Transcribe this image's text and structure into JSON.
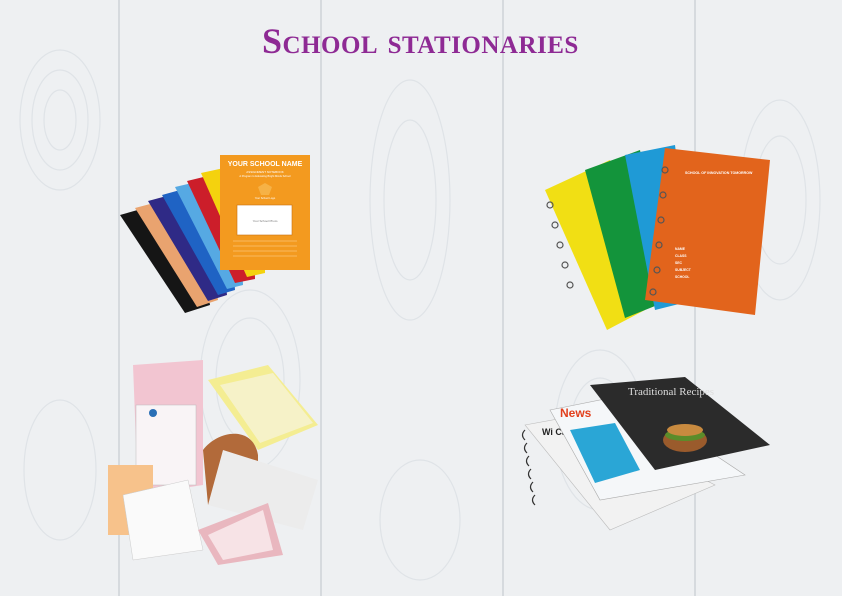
{
  "page": {
    "title": "School stationaries"
  },
  "products": [
    {
      "id": "exercise-books",
      "cover_heading": "YOUR SCHOOL NAME",
      "cover_lines": [
        "ASSIGNMENT NOTEBOOK",
        "A Program to Educating Bright Minds School"
      ],
      "cover_logo_text": "Your School Logo",
      "cover_label_box": "Your School Photo",
      "colors": [
        "#151515",
        "#e9a36f",
        "#2f2a86",
        "#1f63c4",
        "#56a9e3",
        "#cc1e2a",
        "#f4d20e",
        "#f39a1f"
      ]
    },
    {
      "id": "spiral-notebooks",
      "cover_heading": "SCHOOL OF INNOVATION TOMORROW",
      "cover_lines": [
        "NAME",
        "CLASS",
        "SEC",
        "SUBJECT",
        "SCHOOL"
      ],
      "colors": [
        "#f1df14",
        "#13943b",
        "#1f9ad6",
        "#e2641c"
      ]
    },
    {
      "id": "bill-books",
      "colors": [
        "#f2c5d1",
        "#f4ed92",
        "#f6f2c8",
        "#b26a3a"
      ]
    },
    {
      "id": "booklets",
      "cover_title": "Traditional Recipes",
      "mid_title": "News",
      "back_title": "Wi Cat",
      "colors": [
        "#2b2b2b",
        "#2aa6d6",
        "#e2401d",
        "#ffffff"
      ]
    }
  ]
}
